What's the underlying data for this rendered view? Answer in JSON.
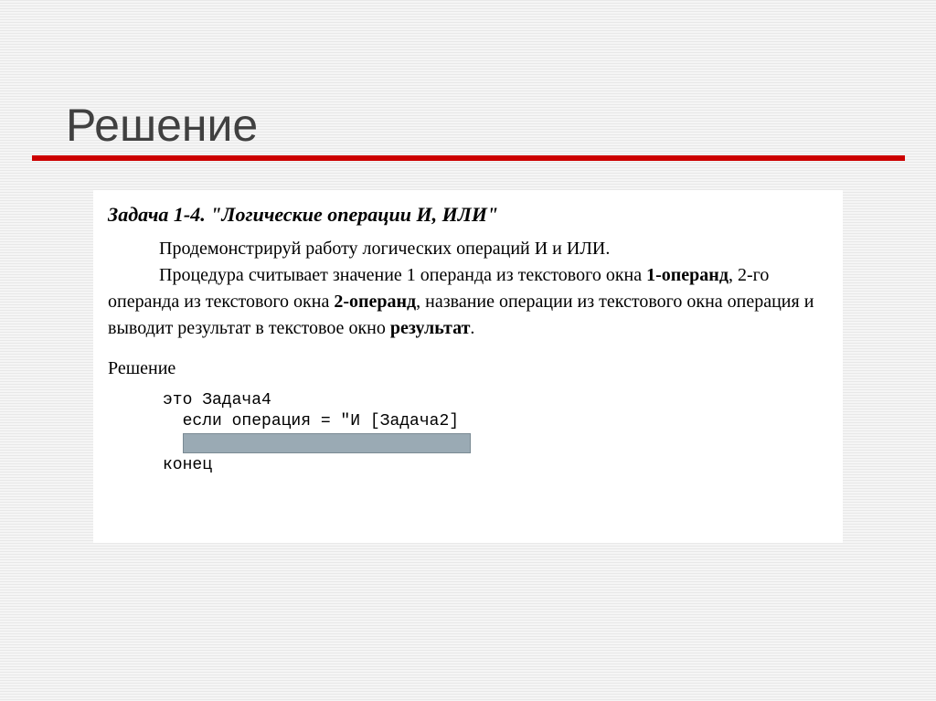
{
  "slide": {
    "title": "Решение"
  },
  "task": {
    "heading": "Задача 1-4. \"Логические операции И, ИЛИ\"",
    "p1": "Продемонстрируй работу логических операций И и ИЛИ.",
    "p2_a": "Процедура считывает значение 1 операнда из текстового окна ",
    "p2_b1": "1-операнд",
    "p2_c": ", 2-го операнда из текстового окна ",
    "p2_b2": "2-операнд",
    "p2_d": ", название операции из текстового окна операция  и выводит результат в текстовое окно ",
    "p2_b3": "результат",
    "p2_e": "."
  },
  "section": {
    "label": "Решение"
  },
  "code": {
    "l1": "это Задача4",
    "l2": "  если операция = \"И [Задача2]",
    "l4": "конец"
  }
}
